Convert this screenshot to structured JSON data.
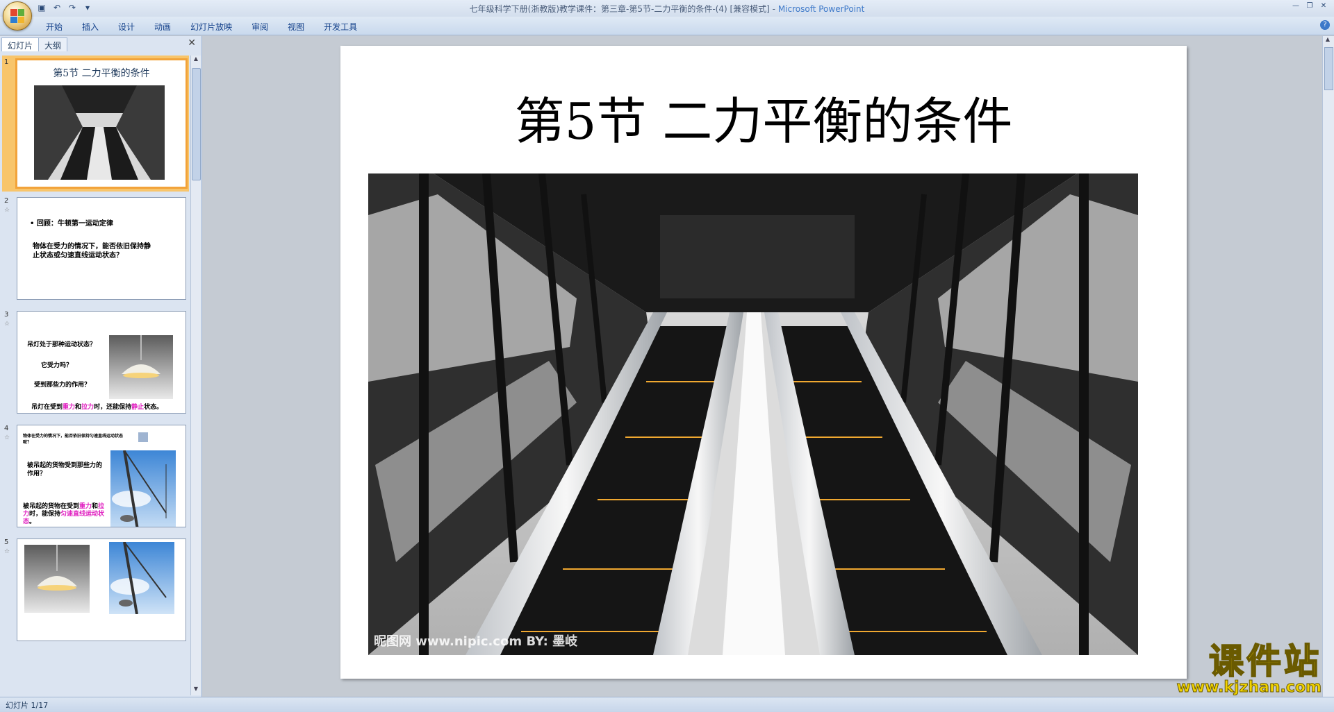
{
  "window": {
    "title": "七年级科学下册(浙教版)教学课件：第三章-第5节-二力平衡的条件-(4) [兼容模式]",
    "app_name": "Microsoft PowerPoint"
  },
  "ribbon": {
    "tabs": [
      "开始",
      "插入",
      "设计",
      "动画",
      "幻灯片放映",
      "审阅",
      "视图",
      "开发工具"
    ]
  },
  "panel": {
    "tabs": [
      "幻灯片",
      "大纲"
    ],
    "close": "✕"
  },
  "thumbnails": [
    {
      "number": "1",
      "title": "第5节   二力平衡的条件",
      "selected": true
    },
    {
      "number": "2",
      "bullet": "• 回顾：牛顿第一运动定律",
      "body": "物体在受力的情况下，能否依旧保持静止状态或匀速直线运动状态？"
    },
    {
      "number": "3",
      "q1": "吊灯处于那种运动状态？",
      "q2": "它受力吗？",
      "q3": "受到那些力的作用？",
      "answer_pre": "吊灯在受到",
      "answer_a": "重力",
      "answer_and": "和",
      "answer_b": "拉力",
      "answer_mid": "时，还能保持",
      "answer_c": "静止",
      "answer_post": "状态。"
    },
    {
      "number": "4",
      "top": "物体在受力的情况下，能否依旧保持匀速直线运动状态呢？",
      "q": "被吊起的货物受到那些力的作用？",
      "answer_pre": "被吊起的货物在受到",
      "answer_a": "重力",
      "answer_and": "和",
      "answer_b": "拉力",
      "answer_mid": "时，能保持",
      "answer_c": "匀速直线运动状态",
      "answer_post": "。"
    },
    {
      "number": "5"
    }
  ],
  "slide": {
    "title": "第5节   二力平衡的条件",
    "photo_caption": "昵图网 www.nipic.com   BY: 墨岐"
  },
  "status": {
    "slide_counter": "幻灯片 1/17"
  },
  "watermark": {
    "line1": "课件站",
    "line2": "www.kjzhan.com"
  }
}
